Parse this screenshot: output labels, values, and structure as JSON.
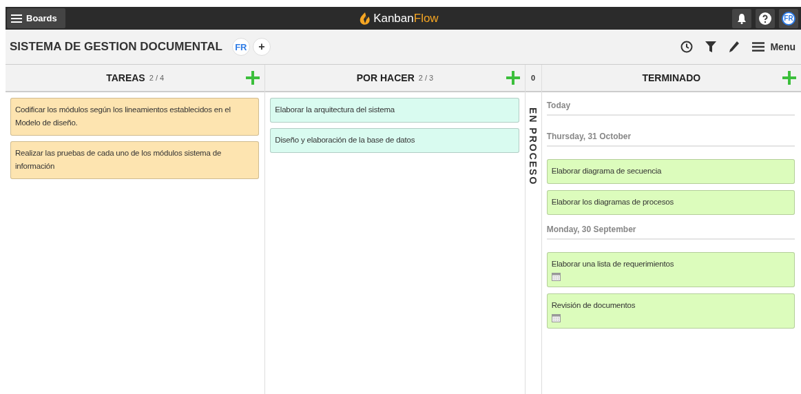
{
  "topbar": {
    "boards_label": "Boards",
    "logo_text": "Kanban",
    "logo_accent": "Flow",
    "user_initials": "FR"
  },
  "board": {
    "title": "SISTEMA DE GESTION DOCUMENTAL",
    "member_initials": "FR",
    "add_label": "+",
    "menu_label": "Menu"
  },
  "columns": [
    {
      "kind": "column",
      "title": "TAREAS",
      "count": "2 / 4",
      "add": true,
      "tasks": [
        {
          "text": "Codificar los módulos según los lineamientos establecidos en el Modelo de diseño.",
          "color": "#fde4b0",
          "calendar": false
        },
        {
          "text": "Realizar las pruebas de cada uno de los módulos sistema de información",
          "color": "#fde4b0",
          "calendar": false
        }
      ]
    },
    {
      "kind": "column",
      "title": "POR HACER",
      "count": "2 / 3",
      "add": true,
      "tasks": [
        {
          "text": "Elaborar la arquitectura del sistema",
          "color": "#d9fbf0",
          "calendar": false
        },
        {
          "text": "Diseño y elaboración de la base de datos",
          "color": "#d9fbf0",
          "calendar": false
        }
      ]
    },
    {
      "kind": "collapsed",
      "title": "EN PROCESO",
      "count": "0",
      "add": false
    },
    {
      "kind": "done",
      "title": "TERMINADO",
      "add": true,
      "groups": [
        {
          "date": "Today"
        },
        {
          "date": "Thursday, 31 October",
          "tasks": [
            {
              "text": "Elaborar diagrama de secuencia",
              "color": "#dcfcbc",
              "calendar": false
            },
            {
              "text": "Elaborar los diagramas de procesos",
              "color": "#dcfcbc",
              "calendar": false
            }
          ]
        },
        {
          "date": "Monday, 30 September",
          "tasks": [
            {
              "text": "Elaborar una lista de requerimientos",
              "color": "#dcfcbc",
              "calendar": true
            },
            {
              "text": "Revisión de documentos",
              "color": "#dcfcbc",
              "calendar": true
            }
          ]
        }
      ]
    }
  ]
}
